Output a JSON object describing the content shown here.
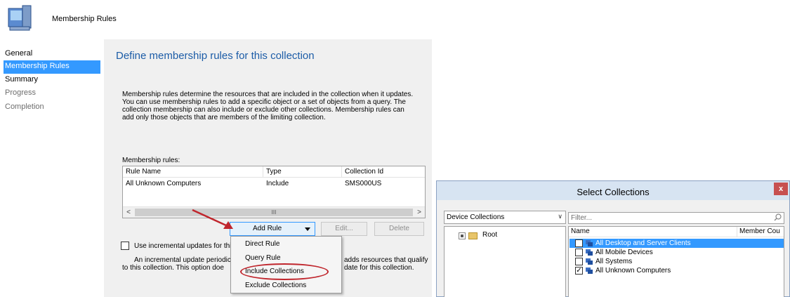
{
  "header": {
    "title": "Membership Rules",
    "icon": "computer-icon"
  },
  "nav": {
    "items": [
      {
        "label": "General",
        "state": "normal"
      },
      {
        "label": "Membership Rules",
        "state": "active"
      },
      {
        "label": "Summary",
        "state": "normal"
      },
      {
        "label": "Progress",
        "state": "disabled"
      },
      {
        "label": "Completion",
        "state": "disabled"
      }
    ]
  },
  "main": {
    "title": "Define membership rules for this collection",
    "description": "Membership rules determine the resources that are included in the collection when it updates. You can use membership rules to add a specific object or a set of objects from a query. The collection membership can also include or exclude other collections. Membership rules can add only those objects that are members of the limiting collection.",
    "rules_label": "Membership rules:",
    "columns": [
      "Rule Name",
      "Type",
      "Collection Id"
    ],
    "rows": [
      {
        "rule_name": "All Unknown Computers",
        "type": "Include",
        "collection_id": "SMS000US"
      }
    ],
    "scroll_left": "<",
    "scroll_right": ">",
    "scroll_thumb": "III",
    "buttons": {
      "add_rule": "Add Rule",
      "edit": "Edit...",
      "delete": "Delete"
    },
    "incremental_label": "Use incremental updates for this c",
    "incremental_desc_left": "An incremental update periodicall",
    "incremental_desc_left2": "to this collection. This option doe",
    "incremental_desc_right": "adds resources that qualify",
    "incremental_desc_right2": "date for this collection."
  },
  "menu": {
    "items": [
      "Direct Rule",
      "Query Rule",
      "Include Collections",
      "Exclude Collections"
    ]
  },
  "dialog": {
    "title": "Select Collections",
    "close": "x",
    "collection_type": "Device Collections",
    "tree_root": "Root",
    "filter_placeholder": "Filter...",
    "columns": [
      "Name",
      "Member Cou"
    ],
    "items": [
      {
        "name": "All Desktop and Server Clients",
        "checked": false,
        "selected": true
      },
      {
        "name": "All Mobile Devices",
        "checked": false,
        "selected": false
      },
      {
        "name": "All Systems",
        "checked": false,
        "selected": false
      },
      {
        "name": "All Unknown Computers",
        "checked": true,
        "selected": false
      }
    ]
  },
  "colors": {
    "accent": "#3399ff",
    "title_blue": "#1c5ca7",
    "annotation_red": "#c0262d"
  }
}
